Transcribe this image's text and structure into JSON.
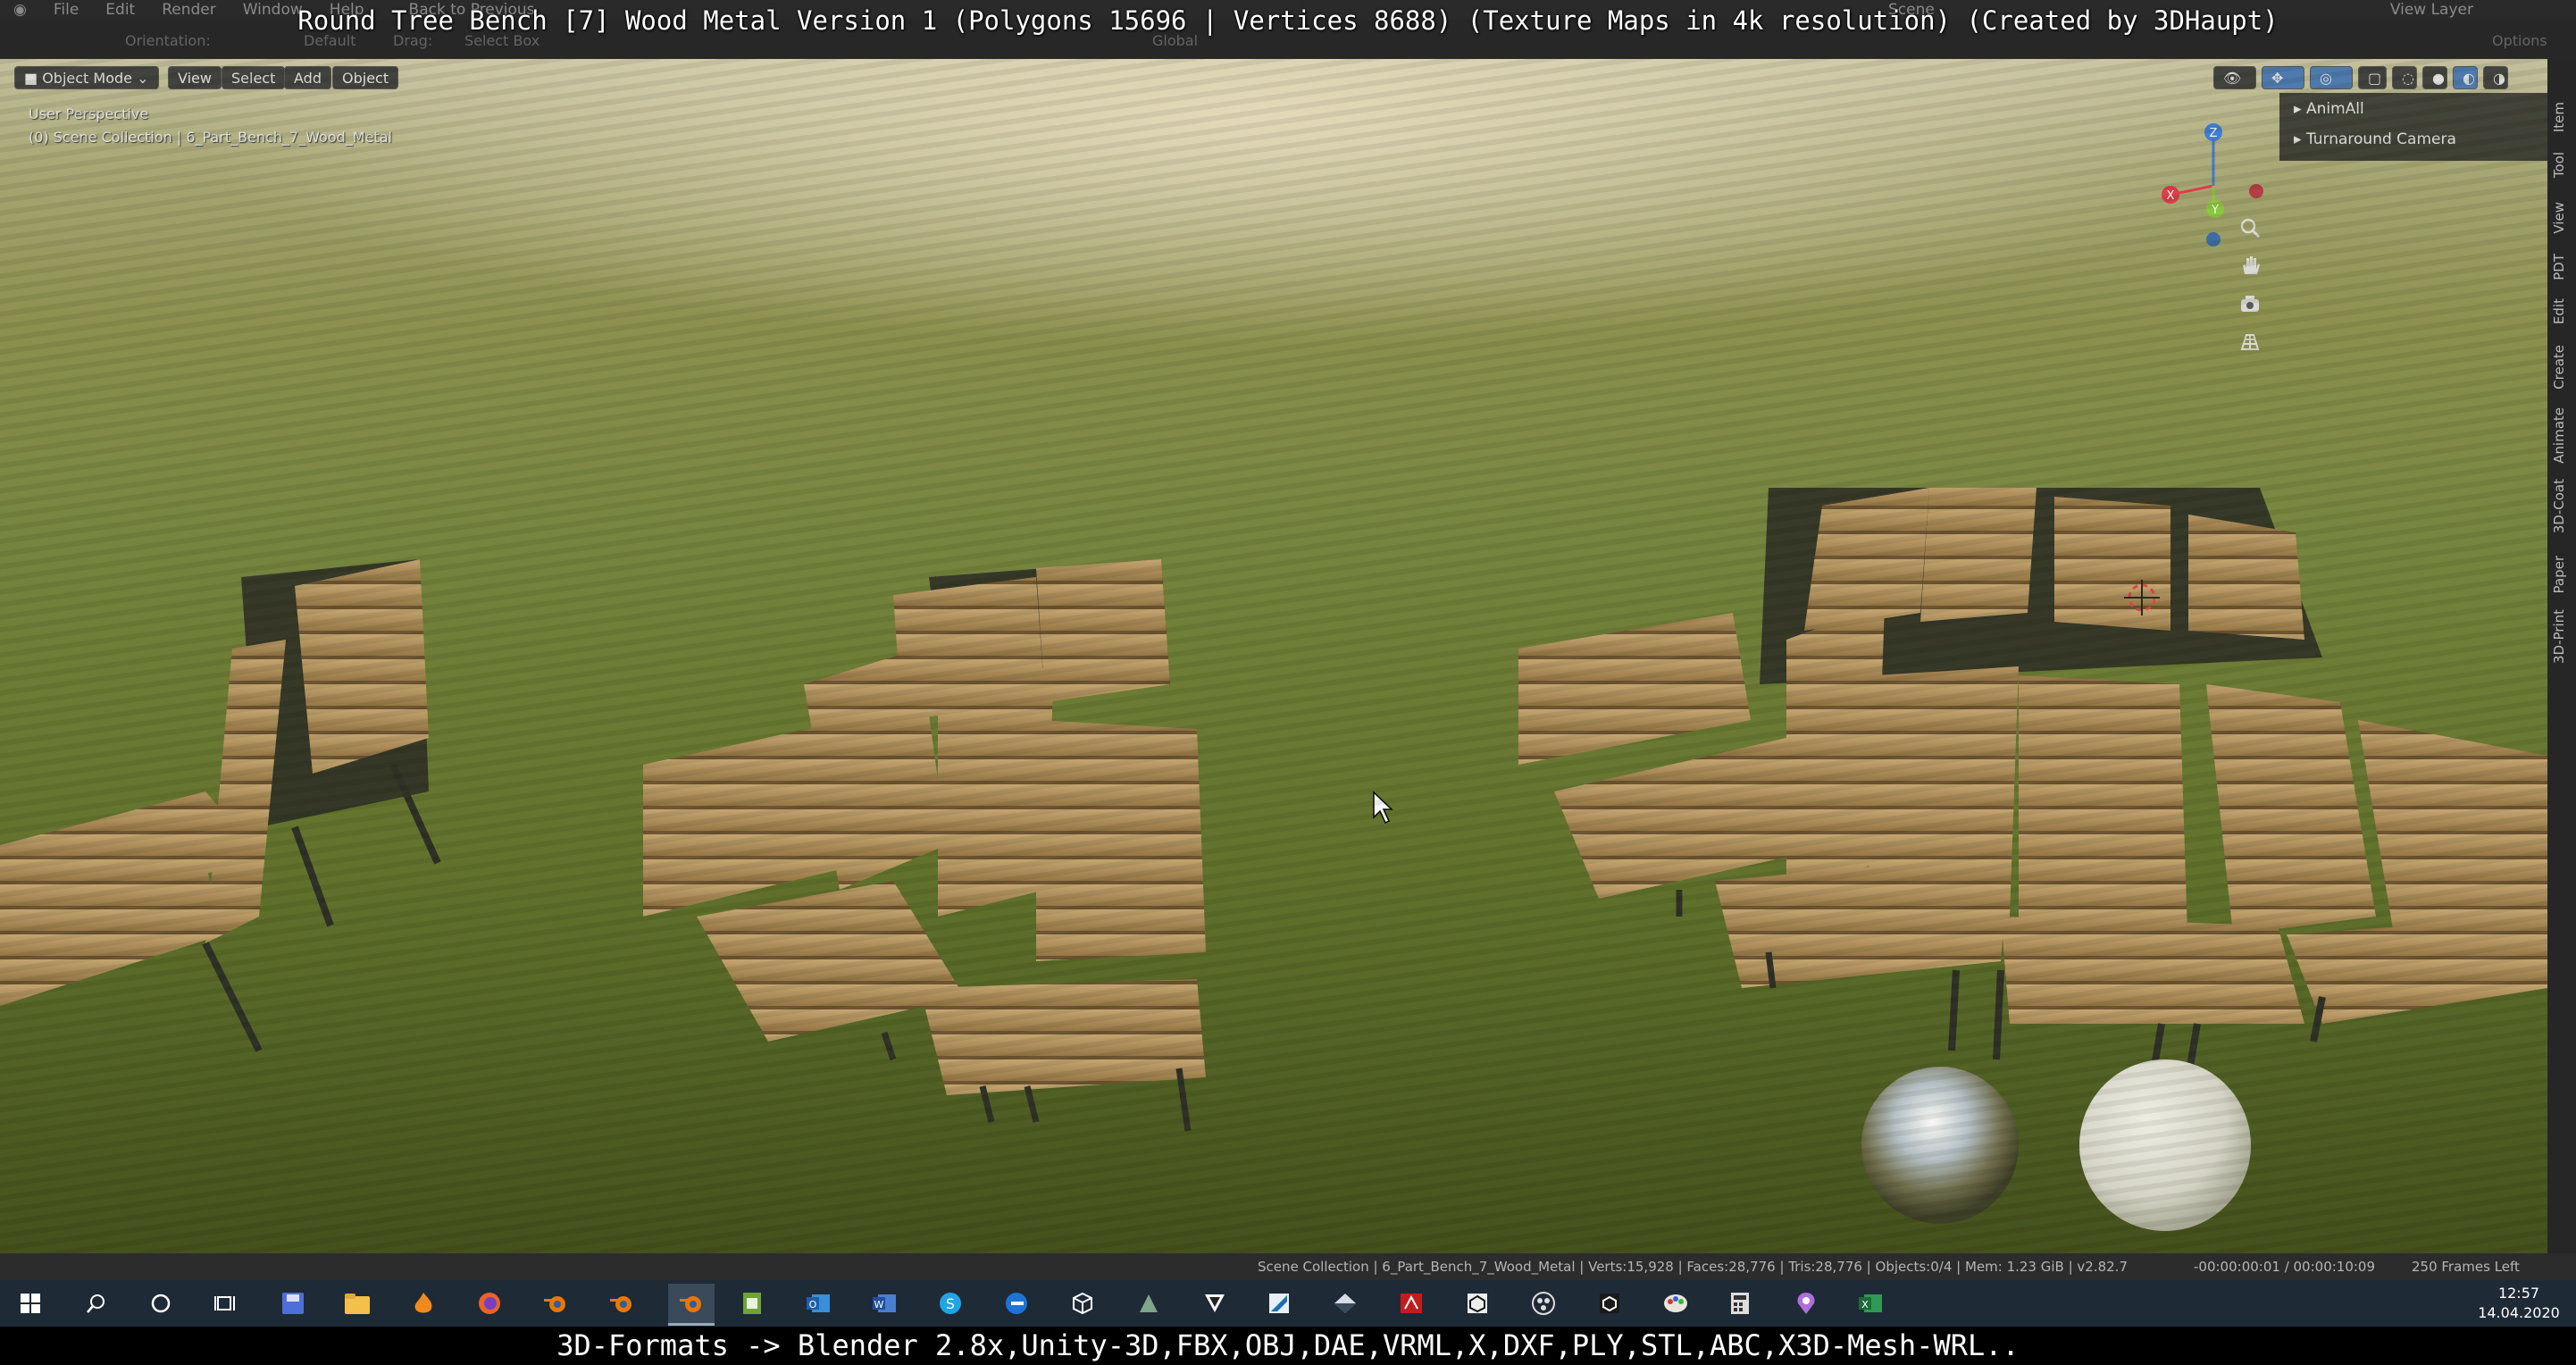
{
  "menubar": {
    "items": [
      "File",
      "Edit",
      "Render",
      "Window",
      "Help"
    ],
    "back": "Back to Previous",
    "scene": "Scene",
    "view_layer": "View Layer"
  },
  "title_overlay": "Round Tree Bench [7] Wood Metal Version 1 (Polygons 15696 | Vertices 8688) (Texture Maps in 4k resolution) (Created by 3DHaupt)",
  "tool_header": {
    "orientation_label": "Orientation:",
    "orientation_value": "Default",
    "drag_label": "Drag:",
    "drag_value": "Select Box",
    "transform": "Global",
    "options": "Options"
  },
  "viewport_header": {
    "mode": "Object Mode",
    "view": "View",
    "select": "Select",
    "add": "Add",
    "object": "Object"
  },
  "viewport_info": {
    "perspective": "User Perspective",
    "collection": "(0) Scene Collection | 6_Part_Bench_7_Wood_Metal"
  },
  "gizmo": {
    "z": "Z",
    "y": "Y",
    "x": "X"
  },
  "npanel": {
    "items": [
      "AnimAll",
      "Turnaround Camera"
    ]
  },
  "side_tabs": [
    "Item",
    "Tool",
    "View",
    "PDT",
    "Edit",
    "Create",
    "Animate",
    "3D-Coat",
    "Paper",
    "3D-Print"
  ],
  "statusbar": {
    "stats": "Scene Collection | 6_Part_Bench_7_Wood_Metal | Verts:15,928 | Faces:28,776 | Tris:28,776 | Objects:0/4 | Mem: 1.23 GiB | v2.82.7",
    "time": "-00:00:00:01 / 00:00:10:09",
    "frames": "250 Frames Left"
  },
  "taskbar": {
    "clock_time": "12:57",
    "clock_date": "14.04.2020"
  },
  "bottom_caption": "3D-Formats -> Blender 2.8x,Unity-3D,FBX,OBJ,DAE,VRML,X,DXF,PLY,STL,ABC,X3D-Mesh-WRL..",
  "colors": {
    "viewport_bg": "#6a7a33",
    "wood": "#a88552",
    "metal": "#2a2a24",
    "axis_x": "#e0394a",
    "axis_y": "#8bc83a",
    "axis_z": "#3b7bd8"
  }
}
